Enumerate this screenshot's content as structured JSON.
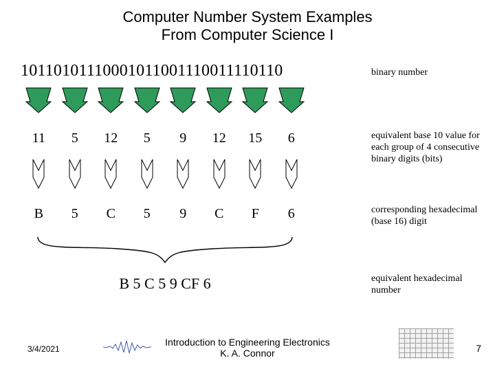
{
  "title_line1": "Computer Number System Examples",
  "title_line2": "From Computer Science I",
  "binary": "10110101110001011001110011110110",
  "labels": {
    "binary": "binary number",
    "base10": "equivalent base 10 value for each group of 4 consecutive binary digits (bits)",
    "hexdigit": "corresponding hexadecimal (base 16) digit",
    "hexnum": "equivalent hexadecimal number"
  },
  "base10_groups": [
    "11",
    "5",
    "12",
    "5",
    "9",
    "12",
    "15",
    "6"
  ],
  "hex_digits": [
    "B",
    "5",
    "C",
    "5",
    "9",
    "C",
    "F",
    "6"
  ],
  "hex_number": "B 5 C 5 9 CF 6",
  "footer": {
    "date": "3/4/2021",
    "course": "Introduction to Engineering Electronics",
    "author": "K. A. Connor",
    "page": "7"
  }
}
